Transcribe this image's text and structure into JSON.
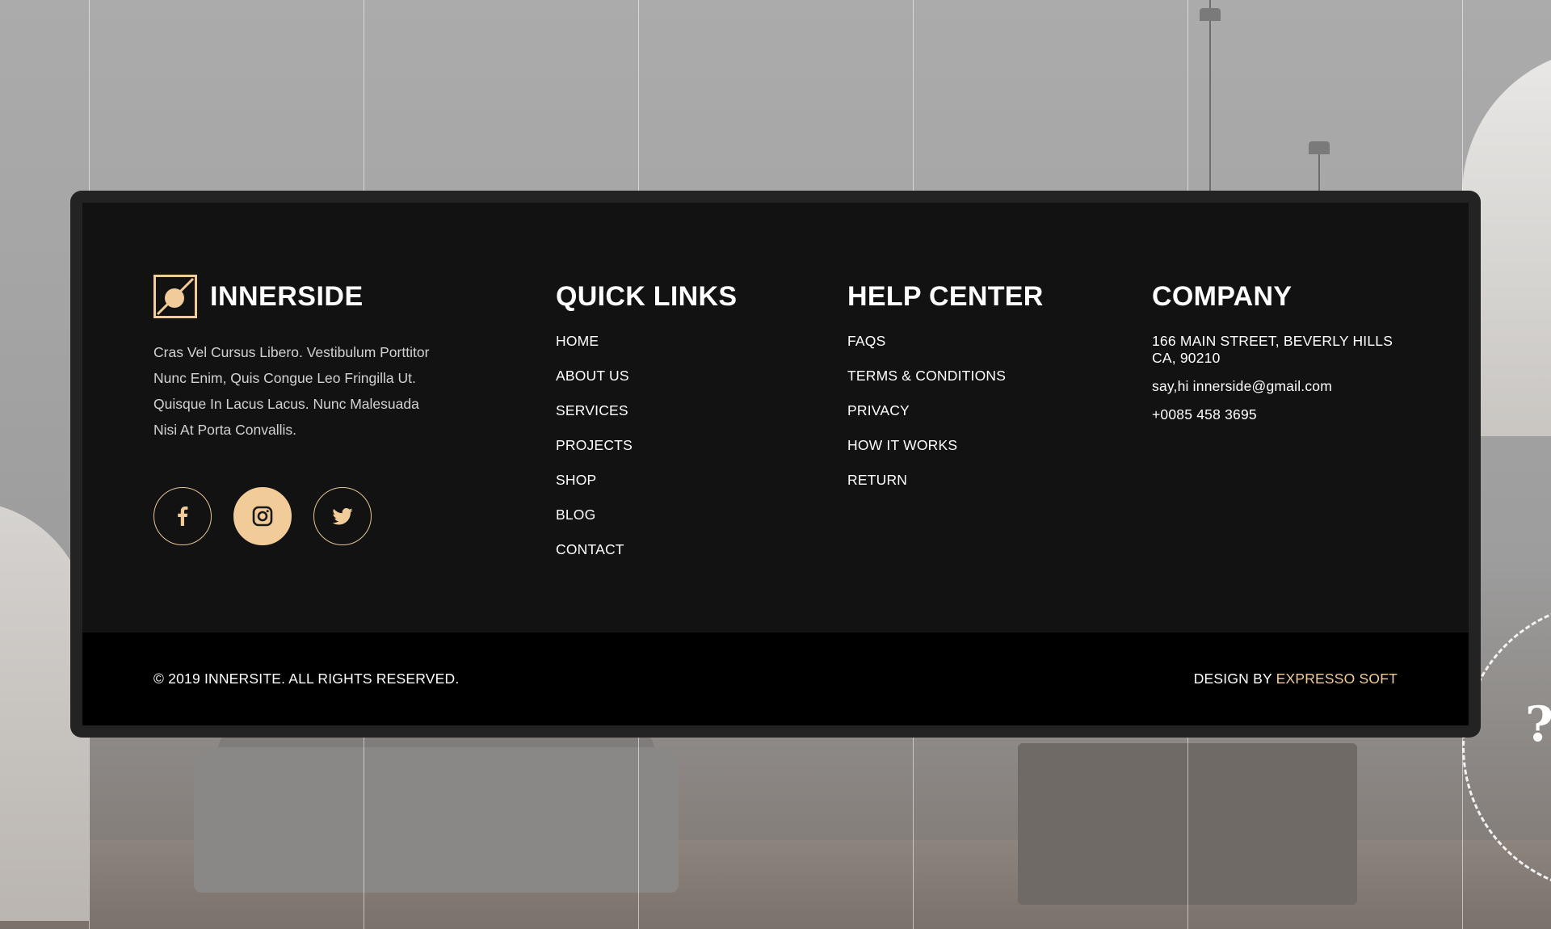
{
  "colors": {
    "accent": "#f1cc98",
    "card_background": "#121212",
    "card_border": "#232323",
    "bottom_bar": "#000000",
    "text": "#ffffff"
  },
  "brand": {
    "name": "INNERSIDE",
    "logo_icon": "square-circle-slash-logo-icon",
    "description_lines": [
      "Cras Vel Cursus Libero. Vestibulum Porttitor",
      "Nunc Enim, Quis Congue Leo Fringilla Ut.",
      "Quisque In Lacus Lacus. Nunc Malesuada",
      "Nisi At Porta Convallis."
    ]
  },
  "socials": [
    {
      "name": "facebook",
      "icon": "facebook-icon",
      "active": false
    },
    {
      "name": "instagram",
      "icon": "instagram-icon",
      "active": true
    },
    {
      "name": "twitter",
      "icon": "twitter-icon",
      "active": false
    }
  ],
  "quick_links": {
    "title": "QUICK LINKS",
    "items": [
      "HOME",
      "ABOUT US",
      "SERVICES",
      "PROJECTS",
      "SHOP",
      "BLOG",
      "CONTACT"
    ]
  },
  "help_center": {
    "title": "HELP CENTER",
    "items": [
      "FAQS",
      "TERMS & CONDITIONS",
      "PRIVACY",
      "HOW IT WORKS",
      "RETURN"
    ]
  },
  "company": {
    "title": "COMPANY",
    "address_line1": "166 MAIN STREET, BEVERLY HILLS",
    "address_line2": "CA, 90210",
    "email": "say,hi innerside@gmail.com",
    "phone": "+0085 458 3695"
  },
  "footer_bottom": {
    "copyright": "© 2019 INNERSITE. ALL RIGHTS RESERVED.",
    "credit_prefix": "DESIGN BY",
    "credit_name": "EXPRESSO SOFT"
  }
}
